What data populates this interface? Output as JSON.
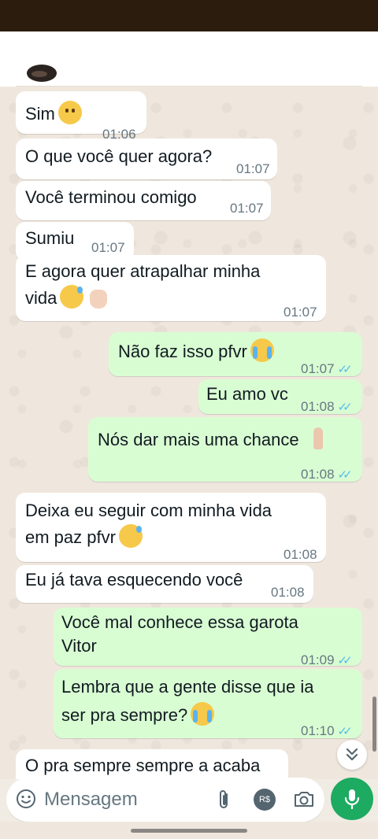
{
  "colors": {
    "incoming_bubble": "#ffffff",
    "outgoing_bubble": "#d9fdd3",
    "read_ticks": "#53bdeb",
    "mic_button": "#1daa61",
    "chat_background": "#efe7dd"
  },
  "messages": [
    {
      "direction": "in",
      "text": "Sim",
      "emoji": "slightly-frowning-face",
      "time": "01:06"
    },
    {
      "direction": "in",
      "text": "O que você quer agora?",
      "time": "01:07"
    },
    {
      "direction": "in",
      "text": "Você terminou comigo",
      "time": "01:07"
    },
    {
      "direction": "in",
      "text": "Sumiu",
      "time": "01:07"
    },
    {
      "direction": "in",
      "line1": "E agora quer atrapalhar minha",
      "line2": "vida",
      "emoji": "sad-sweat-face, raised-hand",
      "time": "01:07"
    },
    {
      "direction": "out",
      "text": "Não faz isso pfvr",
      "emoji": "loudly-crying-face",
      "time": "01:07",
      "status": "read"
    },
    {
      "direction": "out",
      "text": "Eu amo vc",
      "time": "01:08",
      "status": "read"
    },
    {
      "direction": "out",
      "text": "Nós dar mais uma chance",
      "emoji": "folded-hands",
      "time": "01:08",
      "status": "read"
    },
    {
      "direction": "in",
      "line1": "Deixa eu seguir com minha vida",
      "line2": "em paz pfvr",
      "emoji": "sad-sweat-face",
      "time": "01:08"
    },
    {
      "direction": "in",
      "text": "Eu já tava esquecendo você",
      "time": "01:08"
    },
    {
      "direction": "out",
      "line1": "Você mal conhece essa garota",
      "line2": "Vitor",
      "time": "01:09",
      "status": "read"
    },
    {
      "direction": "out",
      "line1": "Lembra que a gente disse que ia",
      "line2": "ser pra sempre?",
      "emoji": "loudly-crying-face",
      "time": "01:10",
      "status": "read"
    },
    {
      "direction": "in",
      "text": "O pra sempre sempre a acaba"
    }
  ],
  "composer": {
    "placeholder": "Mensagem",
    "icons": [
      "smiley-icon",
      "paperclip-icon",
      "payment-icon",
      "camera-icon",
      "mic-icon"
    ],
    "pay_label": "R$"
  },
  "scroll_button_icon": "double-chevron-down-icon"
}
